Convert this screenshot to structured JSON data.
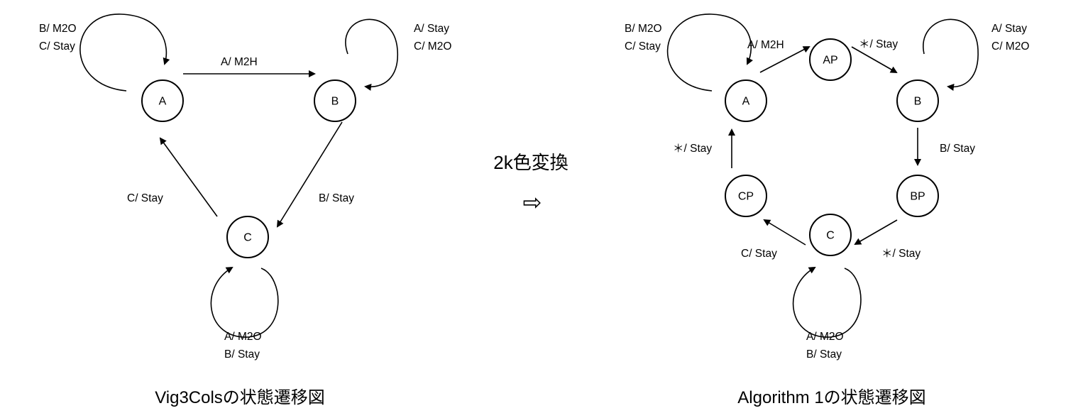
{
  "left_diagram": {
    "caption": "Vig3Colsの状態遷移図",
    "nodes": {
      "A": "A",
      "B": "B",
      "C": "C"
    },
    "loop_labels": {
      "A": [
        "B/ M2O",
        "C/ Stay"
      ],
      "B": [
        "A/ Stay",
        "C/ M2O"
      ],
      "C": [
        "A/ M2O",
        "B/ Stay"
      ]
    },
    "edge_labels": {
      "A_to_B": "A/ M2H",
      "B_to_C": "B/ Stay",
      "C_to_A": "C/ Stay"
    }
  },
  "conversion": {
    "label": "2k色変換",
    "arrow": "⇨"
  },
  "right_diagram": {
    "caption": "Algorithm 1の状態遷移図",
    "nodes": {
      "A": "A",
      "AP": "AP",
      "B": "B",
      "BP": "BP",
      "C": "C",
      "CP": "CP"
    },
    "loop_labels": {
      "A": [
        "B/ M2O",
        "C/ Stay"
      ],
      "B": [
        "A/ Stay",
        "C/ M2O"
      ],
      "C": [
        "A/ M2O",
        "B/ Stay"
      ]
    },
    "edge_labels": {
      "A_to_AP": "A/ M2H",
      "AP_to_B": "＊/ Stay",
      "B_to_BP": "B/ Stay",
      "BP_to_C": "＊/ Stay",
      "C_to_CP": "C/ Stay",
      "CP_to_A": "＊/ Stay"
    }
  }
}
